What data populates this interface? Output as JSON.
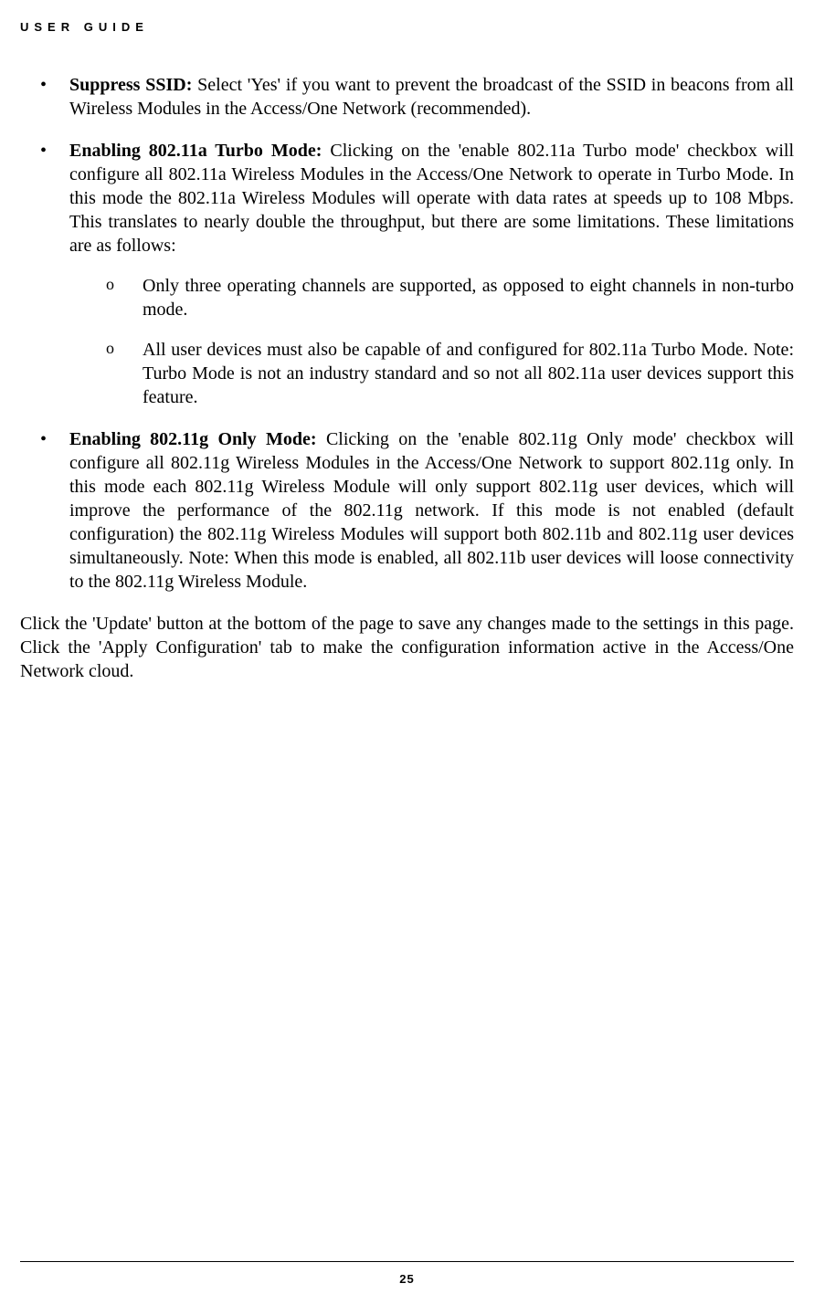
{
  "header": "USER GUIDE",
  "pageNumber": "25",
  "bullets": [
    {
      "title": "Suppress SSID:",
      "body": " Select 'Yes' if you want to prevent the broadcast of the SSID in beacons from all Wireless Modules in the Access/One Network (recommended)."
    },
    {
      "title": "Enabling 802.11a Turbo Mode:",
      "body": " Clicking on the 'enable 802.11a Turbo mode' checkbox will configure all 802.11a Wireless Modules in the Access/One Network to operate in Turbo Mode. In this mode the 802.11a Wireless Modules will operate with data rates at speeds up to 108 Mbps. This translates to nearly double the throughput, but there are some limitations. These limitations are as follows:",
      "subs": [
        "Only three operating channels are supported, as opposed to eight channels in non-turbo mode.",
        "All user devices must also be capable of and configured for 802.11a Turbo Mode. Note: Turbo Mode is not an industry standard and so not all 802.11a user devices support this feature."
      ]
    },
    {
      "title": "Enabling 802.11g Only Mode:",
      "body": " Clicking on the 'enable 802.11g Only mode' checkbox will configure all 802.11g Wireless Modules in the Access/One Network to support 802.11g only. In this mode each 802.11g Wireless Module will only support 802.11g user devices, which will improve the performance of the 802.11g network. If this mode is not enabled (default configuration) the 802.11g Wireless Modules will support both 802.11b and 802.11g user devices simultaneously. Note: When this mode is enabled, all 802.11b user devices will loose connectivity to the 802.11g Wireless Module."
    }
  ],
  "closingPara": "Click the 'Update' button at the bottom of the page to save any changes made to the settings in this page. Click the 'Apply Configuration' tab to make the configuration information active in the Access/One Network cloud."
}
